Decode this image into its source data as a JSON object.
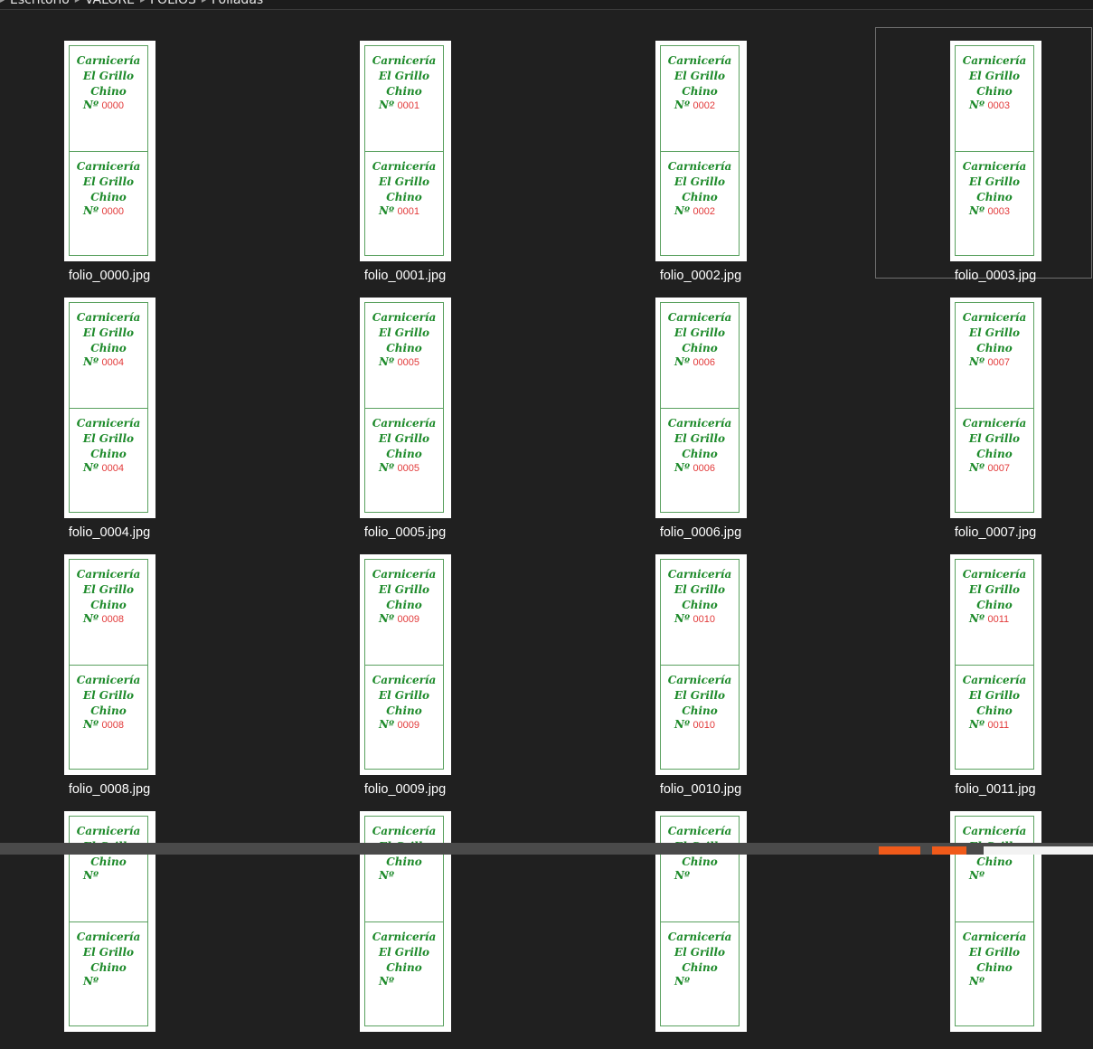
{
  "breadcrumb": {
    "items": [
      "Escritorio",
      "VALORE",
      "FOLIOS",
      "Foliadas"
    ]
  },
  "thumbnail": {
    "shop_line1": "Carnicería",
    "shop_line2": "El Grillo",
    "shop_line3": "Chino",
    "number_label": "Nº",
    "accent_green": "#1d8a2a",
    "number_red": "#e23a3a"
  },
  "files": [
    {
      "name": "folio_0000.jpg",
      "number": "0000"
    },
    {
      "name": "folio_0001.jpg",
      "number": "0001"
    },
    {
      "name": "folio_0002.jpg",
      "number": "0002"
    },
    {
      "name": "folio_0003.jpg",
      "number": "0003",
      "selected": true
    },
    {
      "name": "folio_0004.jpg",
      "number": "0004"
    },
    {
      "name": "folio_0005.jpg",
      "number": "0005"
    },
    {
      "name": "folio_0006.jpg",
      "number": "0006"
    },
    {
      "name": "folio_0007.jpg",
      "number": "0007"
    },
    {
      "name": "folio_0008.jpg",
      "number": "0008"
    },
    {
      "name": "folio_0009.jpg",
      "number": "0009"
    },
    {
      "name": "folio_0010.jpg",
      "number": "0010"
    },
    {
      "name": "folio_0011.jpg",
      "number": "0011"
    },
    {
      "name": "",
      "number": ""
    },
    {
      "name": "",
      "number": ""
    },
    {
      "name": "",
      "number": ""
    },
    {
      "name": "",
      "number": ""
    }
  ]
}
